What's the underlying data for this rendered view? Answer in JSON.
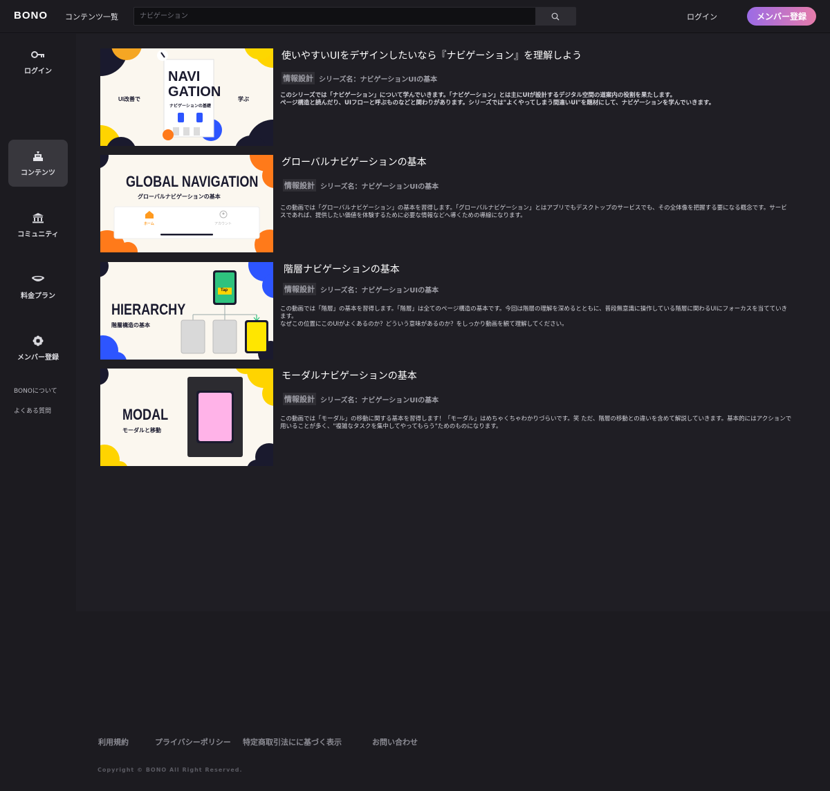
{
  "header": {
    "logo": "BONO",
    "nav_link": "コンテンツ一覧",
    "search_placeholder": "ナビゲーション",
    "login": "ログイン",
    "member_button": "メンバー登録",
    "member_gradient": [
      "#9b6be6",
      "#e67caa"
    ]
  },
  "sidebar": {
    "items": [
      {
        "label": "ログイン",
        "icon": "key-icon"
      },
      {
        "label": "コンテンツ",
        "icon": "book-stack-icon",
        "active": true
      },
      {
        "label": "コミュニティ",
        "icon": "building-icon"
      },
      {
        "label": "料金プラン",
        "icon": "bowl-icon"
      },
      {
        "label": "メンバー登録",
        "icon": "flower-icon"
      }
    ],
    "links": [
      "BONOについて",
      "よくある質問"
    ]
  },
  "cards": [
    {
      "title": "使いやすいUIをデザインしたいなら『ナビゲーション』を理解しよう",
      "tag": "情報設計",
      "series": "シリーズ名：ナビゲーションUIの基本",
      "desc": "このシリーズでは「ナビゲーション」について学んでいきます。「ナビゲーション」とは主にUIが設計するデジタル空間の道案内の役割を果たします。\nページ構造と読んだり、UIフローと呼ぶものなどと関わりがあります。シリーズでは\"よくやってしまう間違いUI\"を題材にして、ナビゲーションを学んでいきます。",
      "thumb": {
        "left": "UI改善で",
        "right": "学ぶ",
        "big1": "NAVI",
        "big2": "GATION",
        "sub": "ナビゲーションの基礎"
      }
    },
    {
      "title": "グローバルナビゲーションの基本",
      "tag": "情報設計",
      "series": "シリーズ名：ナビゲーションUIの基本",
      "desc": "この動画では「グローバルナビゲーション」の基本を習得します。「グローバルナビゲーション」とはアプリでもデスクトップのサービスでも、その全体像を把握する要になる概念です。サービスであれば、提供したい価値を体験するために必要な情報などへ導くための導線になります。",
      "thumb": {
        "big": "GLOBAL NAVIGATION",
        "sub": "グローバルナビゲーションの基本",
        "tab1": "ホーム",
        "tab2": "アカウント"
      }
    },
    {
      "title": "階層ナビゲーションの基本",
      "tag": "情報設計",
      "series": "シリーズ名：ナビゲーションUIの基本",
      "desc": "この動画では「階層」の基本を習得します。「階層」は全てのページ構造の基本です。今回は階層の理解を深めるとともに、普段無意識に操作している階層に関わるUIにフォーカスを当てていきます。\nなぜこの位置にこのUIがよくあるのか？どういう意味があるのか？をしっかり動画を観て理解してください。",
      "thumb": {
        "big": "HIERARCHY",
        "sub": "階層構造の基本",
        "tap": "Tap"
      }
    },
    {
      "title": "モーダルナビゲーションの基本",
      "tag": "情報設計",
      "series": "シリーズ名：ナビゲーションUIの基本",
      "desc": "この動画では「モーダル」の移動に関する基本を習得します！「モーダル」はめちゃくちゃわかりづらいです。笑 ただ、階層の移動との違いを含めて解説していきます。基本的にはアクションで用いることが多く、\"複雑なタスクを集中してやってもらう\"ためのものになります。",
      "thumb": {
        "big": "MODAL",
        "sub": "モーダルと移動"
      }
    }
  ],
  "footer": {
    "links": [
      "利用規約",
      "プライバシーポリシー",
      "特定商取引法にに基づく表示",
      "お問い合わせ"
    ],
    "copyright": "Copyright © BONO All Right Reserved."
  }
}
